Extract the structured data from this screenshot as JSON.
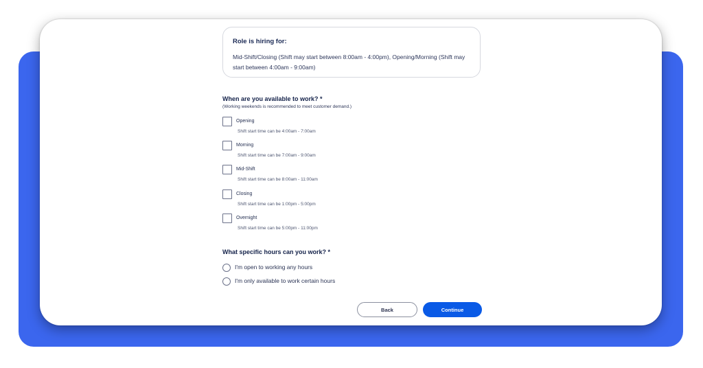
{
  "role": {
    "title": "Role is hiring for:",
    "description": "Mid-Shift/Closing (Shift may start between 8:00am - 4:00pm), Opening/Morning (Shift may start between 4:00am - 9:00am)"
  },
  "availability": {
    "question": "When are you available to work? *",
    "note": "(Working weekends is recommended to meet customer demand.)",
    "options": [
      {
        "label": "Opening",
        "detail": "Shift start time can be 4:00am - 7:00am",
        "checked": false
      },
      {
        "label": "Morning",
        "detail": "Shift start time can be 7:00am - 9:00am",
        "checked": false
      },
      {
        "label": "Mid-Shift",
        "detail": "Shift start time can be 8:00am - 11:00am",
        "checked": false
      },
      {
        "label": "Closing",
        "detail": "Shift start time can be 1:00pm - 5:00pm",
        "checked": false
      },
      {
        "label": "Overnight",
        "detail": "Shift start time can be 5:00pm - 11:00pm",
        "checked": false
      }
    ]
  },
  "hours": {
    "question": "What specific hours can you work? *",
    "options": [
      {
        "label": "I'm open to working any hours",
        "selected": false
      },
      {
        "label": "I'm only available to work certain hours",
        "selected": false
      }
    ]
  },
  "buttons": {
    "back": "Back",
    "continue": "Continue"
  },
  "colors": {
    "accent": "#0a5ae6",
    "background_slab": "#3b66ee",
    "heading_text": "#14224a"
  }
}
